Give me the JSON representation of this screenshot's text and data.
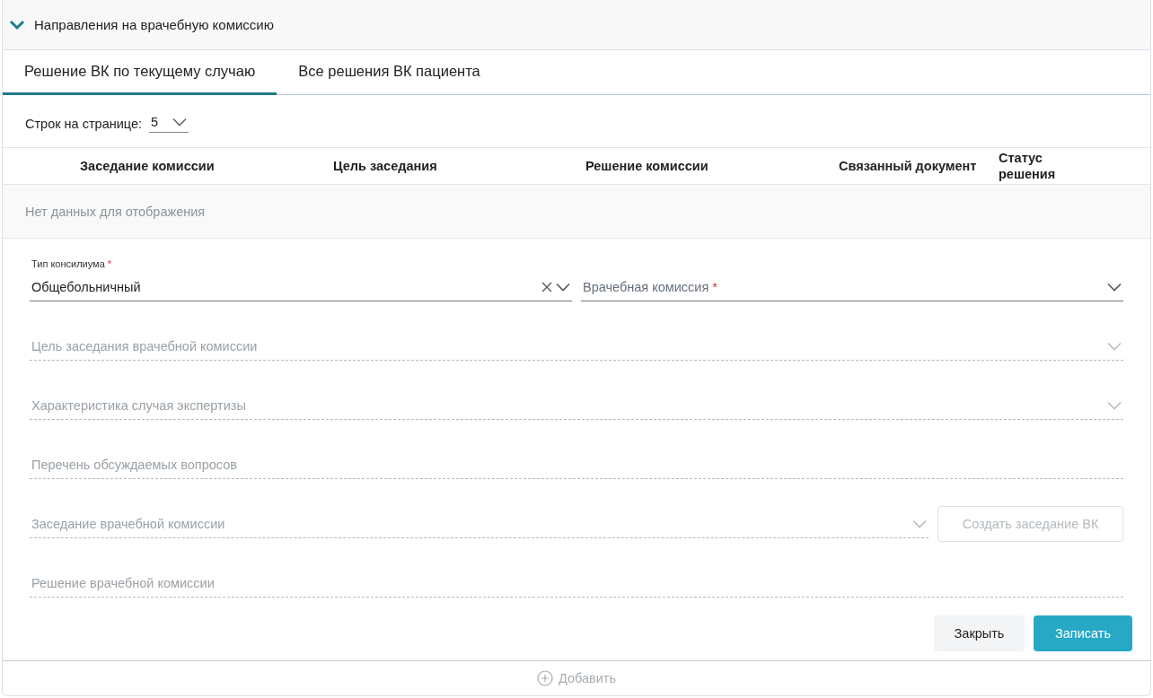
{
  "section": {
    "title": "Направления на врачебную комиссию",
    "expanded": true
  },
  "tabs": [
    {
      "label": "Решение ВК по текущему случаю",
      "selected": true
    },
    {
      "label": "Все решения ВК пациента",
      "selected": false
    }
  ],
  "pager": {
    "label": "Строк на странице:",
    "value": "5"
  },
  "table": {
    "columns": [
      "Заседание комиссии",
      "Цель заседания",
      "Решение комиссии",
      "Связанный документ",
      "Статус решения"
    ],
    "empty_message": "Нет данных для отображения"
  },
  "form": {
    "rows": [
      [
        {
          "kind": "select",
          "label": "Тип консилиума",
          "required_mark": "*",
          "value": "Общебольничный",
          "clearable": true,
          "disabled": false
        },
        {
          "kind": "select",
          "placeholder": "Врачебная комиссия",
          "required_mark": "*",
          "clearable": false,
          "disabled": false
        }
      ],
      [
        {
          "kind": "select",
          "placeholder": "Цель заседания врачебной комиссии",
          "clearable": false,
          "disabled": true
        }
      ],
      [
        {
          "kind": "select",
          "placeholder": "Характеристика случая экспертизы",
          "clearable": false,
          "disabled": true
        }
      ],
      [
        {
          "kind": "text",
          "placeholder": "Перечень обсуждаемых вопросов",
          "disabled": true
        }
      ],
      [
        {
          "kind": "select",
          "placeholder": "Заседание врачебной комиссии",
          "clearable": false,
          "disabled": true
        },
        {
          "kind": "button",
          "label": "Создать заседание ВК",
          "disabled": true
        }
      ],
      [
        {
          "kind": "text",
          "placeholder": "Решение врачебной комиссии",
          "disabled": true
        }
      ]
    ]
  },
  "actions": [
    {
      "label": "Закрыть",
      "kind": "secondary"
    },
    {
      "label": "Записать",
      "kind": "primary"
    }
  ],
  "add_button": {
    "label": "Добавить",
    "disabled": true
  }
}
